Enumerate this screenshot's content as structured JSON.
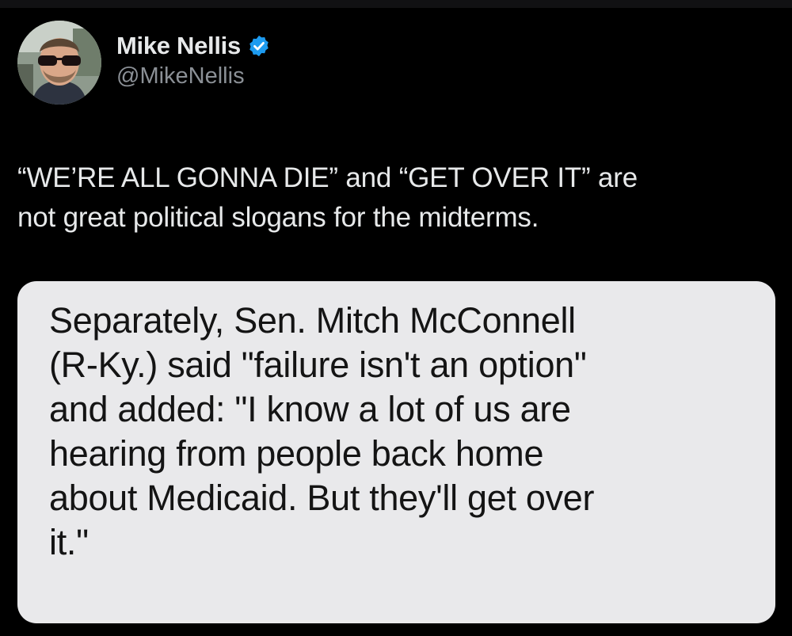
{
  "author": {
    "display_name": "Mike Nellis",
    "handle": "@MikeNellis",
    "verified": true,
    "verified_color": "#1d9bf0",
    "avatar_icon": "profile-photo"
  },
  "tweet": {
    "text": "“WE’RE ALL GONNA DIE” and “GET OVER IT” are\nnot great political slogans for the midterms."
  },
  "media": {
    "quote_text": "Separately, Sen. Mitch McConnell\n(R-Ky.) said \"failure isn't an option\"\nand added: \"I know a lot of us are\nhearing from people back home\nabout Medicaid. But they'll get over\nit.\"",
    "background_color": "#e9e9eb"
  },
  "theme": {
    "background": "#000000",
    "text_primary": "#e7e9ea",
    "text_secondary": "#8b9096"
  }
}
